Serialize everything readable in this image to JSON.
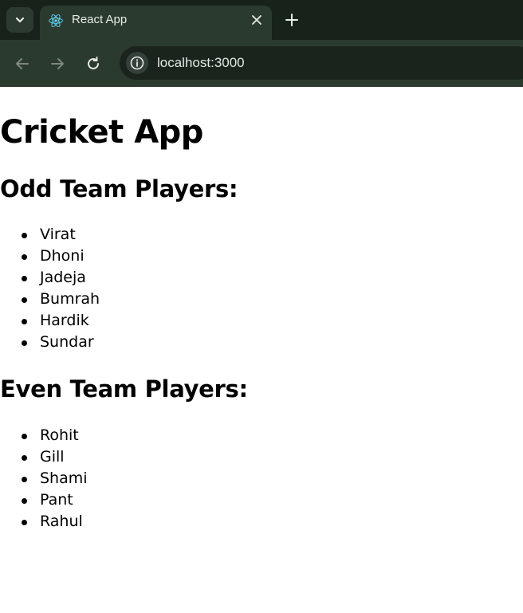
{
  "browser": {
    "tab_title": "React App",
    "url": "localhost:3000"
  },
  "page": {
    "title": "Cricket App",
    "odd_heading": "Odd Team Players:",
    "odd_players": [
      "Virat",
      "Dhoni",
      "Jadeja",
      "Bumrah",
      "Hardik",
      "Sundar"
    ],
    "even_heading": "Even Team Players:",
    "even_players": [
      "Rohit",
      "Gill",
      "Shami",
      "Pant",
      "Rahul"
    ]
  },
  "icons": {
    "tab_search": "chevron-down-icon",
    "favicon": "react-logo-icon",
    "close": "close-icon",
    "new_tab": "plus-icon",
    "back": "arrow-left-icon",
    "forward": "arrow-right-icon",
    "reload": "reload-icon",
    "site_info": "info-icon"
  },
  "colors": {
    "tab_strip": "#16221a",
    "toolbar": "#2b3a2f",
    "react_blue": "#61dafb"
  }
}
